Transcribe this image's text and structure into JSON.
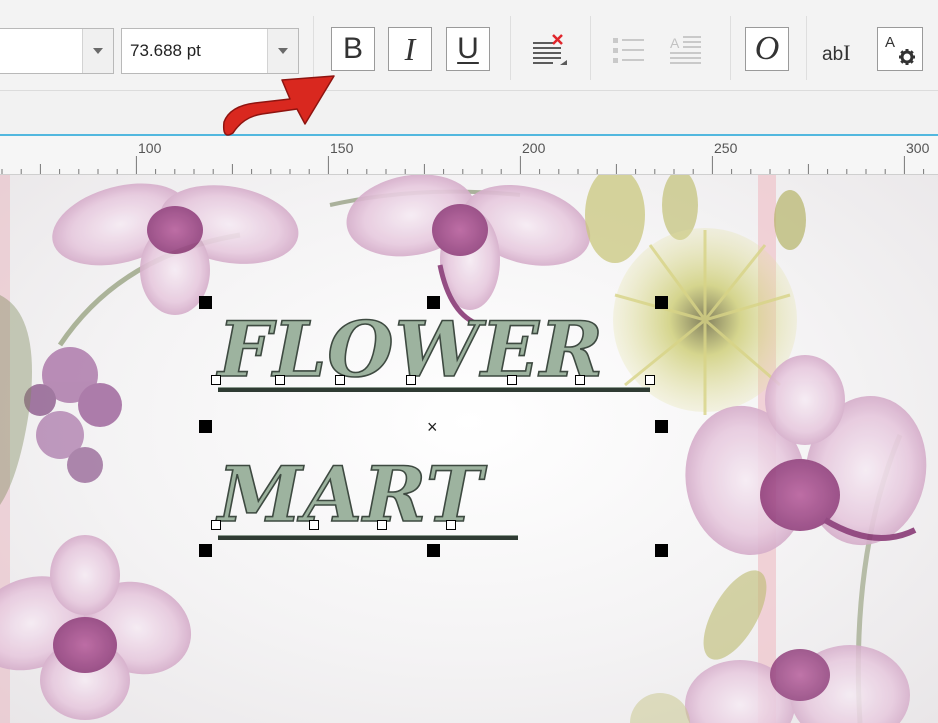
{
  "toolbar": {
    "font_name": "",
    "font_size": "73.688 pt",
    "bold_label": "B",
    "italic_label": "I",
    "underline_label": "U",
    "uppercase_label": "O",
    "text_edit_label": "ab",
    "text_settings_label": "A",
    "icons": [
      "dropdown-icon",
      "remove-formatting-icon",
      "bullet-list-icon",
      "drop-cap-icon",
      "text-edit-icon",
      "text-properties-icon"
    ]
  },
  "ruler": {
    "labels": [
      "100",
      "150",
      "200",
      "250",
      "300"
    ]
  },
  "canvas": {
    "text_lines": [
      "FLOWER",
      "MART"
    ],
    "fill_color": "#9db39f",
    "outline_color": "#3e4a41",
    "selection_handle_color": "#000000"
  },
  "annotation": {
    "arrow_color": "#d9281f"
  }
}
